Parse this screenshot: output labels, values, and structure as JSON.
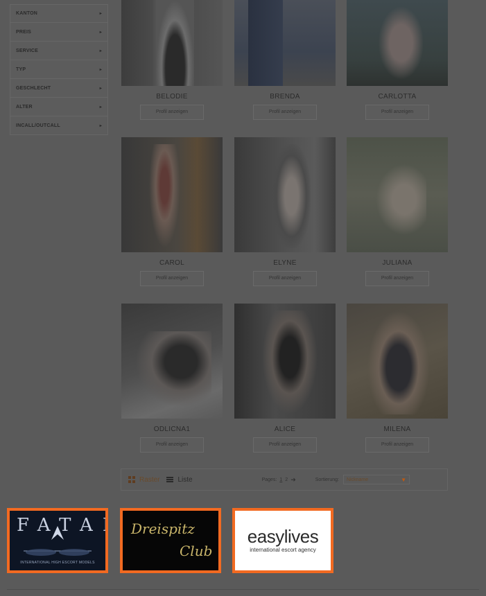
{
  "filters": [
    {
      "label": "KANTON"
    },
    {
      "label": "PREIS"
    },
    {
      "label": "SERVICE"
    },
    {
      "label": "TYP"
    },
    {
      "label": "GESCHLECHT"
    },
    {
      "label": "ALTER"
    },
    {
      "label": "INCALL/OUTCALL"
    }
  ],
  "filter_arrow": "▸",
  "profiles": [
    {
      "name": "BELODIE",
      "button": "Profil anzeigen"
    },
    {
      "name": "BRENDA",
      "button": "Profil anzeigen"
    },
    {
      "name": "CARLOTTA",
      "button": "Profil anzeigen"
    },
    {
      "name": "CAROL",
      "button": "Profil anzeigen"
    },
    {
      "name": "ELYNE",
      "button": "Profil anzeigen"
    },
    {
      "name": "JULIANA",
      "button": "Profil anzeigen"
    },
    {
      "name": "ODLICNA1",
      "button": "Profil anzeigen"
    },
    {
      "name": "ALICE",
      "button": "Profil anzeigen"
    },
    {
      "name": "MILENA",
      "button": "Profil anzeigen"
    }
  ],
  "toolbar": {
    "raster_label": "Raster",
    "list_label": "Liste",
    "pages_label": "Pages:",
    "page_current": "1",
    "page_other": "2",
    "next_arrow": "➜",
    "sort_label": "Sortierung:",
    "sort_value": "Nickname"
  },
  "logos": {
    "fatal_text": "FATAL",
    "fatal_sub": "INTERNATIONAL HIGH ESCORT MODELS",
    "dreispitz_line1": "Dreispitz",
    "dreispitz_line2": "Club",
    "easylives_title": "easylives",
    "easylives_sub": "international escort agency"
  }
}
